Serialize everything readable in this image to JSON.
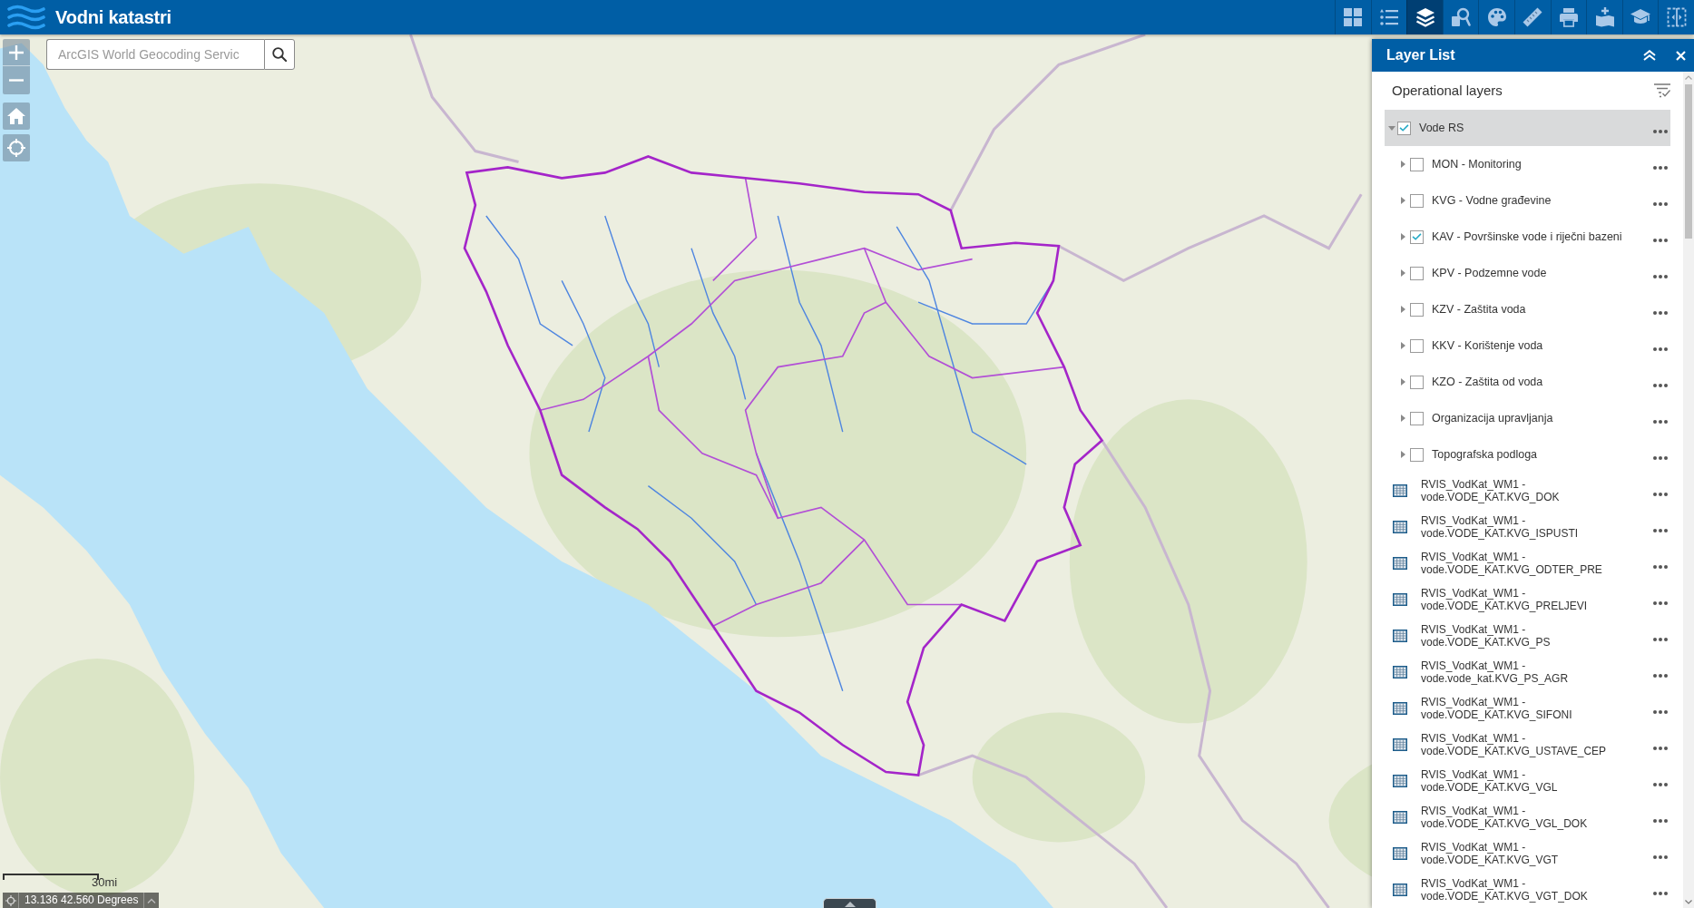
{
  "header": {
    "title": "Vodni katastri"
  },
  "toolbar": [
    {
      "selected": false
    },
    {
      "selected": false
    },
    {
      "selected": true
    },
    {
      "selected": false
    },
    {
      "selected": false
    },
    {
      "selected": false
    },
    {
      "selected": false
    },
    {
      "selected": false
    },
    {
      "selected": false
    },
    {
      "selected": false
    }
  ],
  "map": {
    "search": {
      "placeholder": "ArcGIS World Geocoding Servic"
    },
    "scale_bar": {
      "label": "30mi"
    },
    "coordinates": "13.136 42.560 Degrees"
  },
  "layer_list": {
    "title": "Layer List",
    "section_title": "Operational layers",
    "layers": [
      {
        "kind": "group",
        "label": "Vode RS",
        "checked": true,
        "expanded": true,
        "selected": true,
        "children": [
          {
            "kind": "group",
            "label": "MON - Monitoring",
            "checked": false,
            "expanded": false,
            "selected": false
          },
          {
            "kind": "group",
            "label": "KVG - Vodne građevine",
            "checked": false,
            "expanded": false,
            "selected": false
          },
          {
            "kind": "group",
            "label": "KAV - Površinske vode i riječni bazeni",
            "checked": true,
            "expanded": false,
            "selected": false
          },
          {
            "kind": "group",
            "label": "KPV - Podzemne vode",
            "checked": false,
            "expanded": false,
            "selected": false
          },
          {
            "kind": "group",
            "label": "KZV - Zaštita voda",
            "checked": false,
            "expanded": false,
            "selected": false
          },
          {
            "kind": "group",
            "label": "KKV - Korištenje voda",
            "checked": false,
            "expanded": false,
            "selected": false
          },
          {
            "kind": "group",
            "label": "KZO - Zaštita od voda",
            "checked": false,
            "expanded": false,
            "selected": false
          },
          {
            "kind": "group",
            "label": "Organizacija upravljanja",
            "checked": false,
            "expanded": false,
            "selected": false
          },
          {
            "kind": "group",
            "label": "Topografska podloga",
            "checked": false,
            "expanded": false,
            "selected": false
          }
        ]
      },
      {
        "kind": "table",
        "label": "RVIS_VodKat_WM1 - vode.VODE_KAT.KVG_DOK",
        "selected": false
      },
      {
        "kind": "table",
        "label": "RVIS_VodKat_WM1 - vode.VODE_KAT.KVG_ISPUSTI",
        "selected": false
      },
      {
        "kind": "table",
        "label": "RVIS_VodKat_WM1 - vode.VODE_KAT.KVG_ODTER_PRE",
        "selected": false
      },
      {
        "kind": "table",
        "label": "RVIS_VodKat_WM1 - vode.VODE_KAT.KVG_PRELJEVI",
        "selected": false
      },
      {
        "kind": "table",
        "label": "RVIS_VodKat_WM1 - vode.VODE_KAT.KVG_PS",
        "selected": false
      },
      {
        "kind": "table",
        "label": "RVIS_VodKat_WM1 - vode.vode_kat.KVG_PS_AGR",
        "selected": false
      },
      {
        "kind": "table",
        "label": "RVIS_VodKat_WM1 - vode.VODE_KAT.KVG_SIFONI",
        "selected": false
      },
      {
        "kind": "table",
        "label": "RVIS_VodKat_WM1 - vode.VODE_KAT.KVG_USTAVE_CEP",
        "selected": false
      },
      {
        "kind": "table",
        "label": "RVIS_VodKat_WM1 - vode.VODE_KAT.KVG_VGL",
        "selected": false
      },
      {
        "kind": "table",
        "label": "RVIS_VodKat_WM1 - vode.VODE_KAT.KVG_VGL_DOK",
        "selected": false
      },
      {
        "kind": "table",
        "label": "RVIS_VodKat_WM1 - vode.VODE_KAT.KVG_VGT",
        "selected": false
      },
      {
        "kind": "table",
        "label": "RVIS_VodKat_WM1 - vode.VODE_KAT.KVG_VGT_DOK",
        "selected": false
      }
    ]
  }
}
